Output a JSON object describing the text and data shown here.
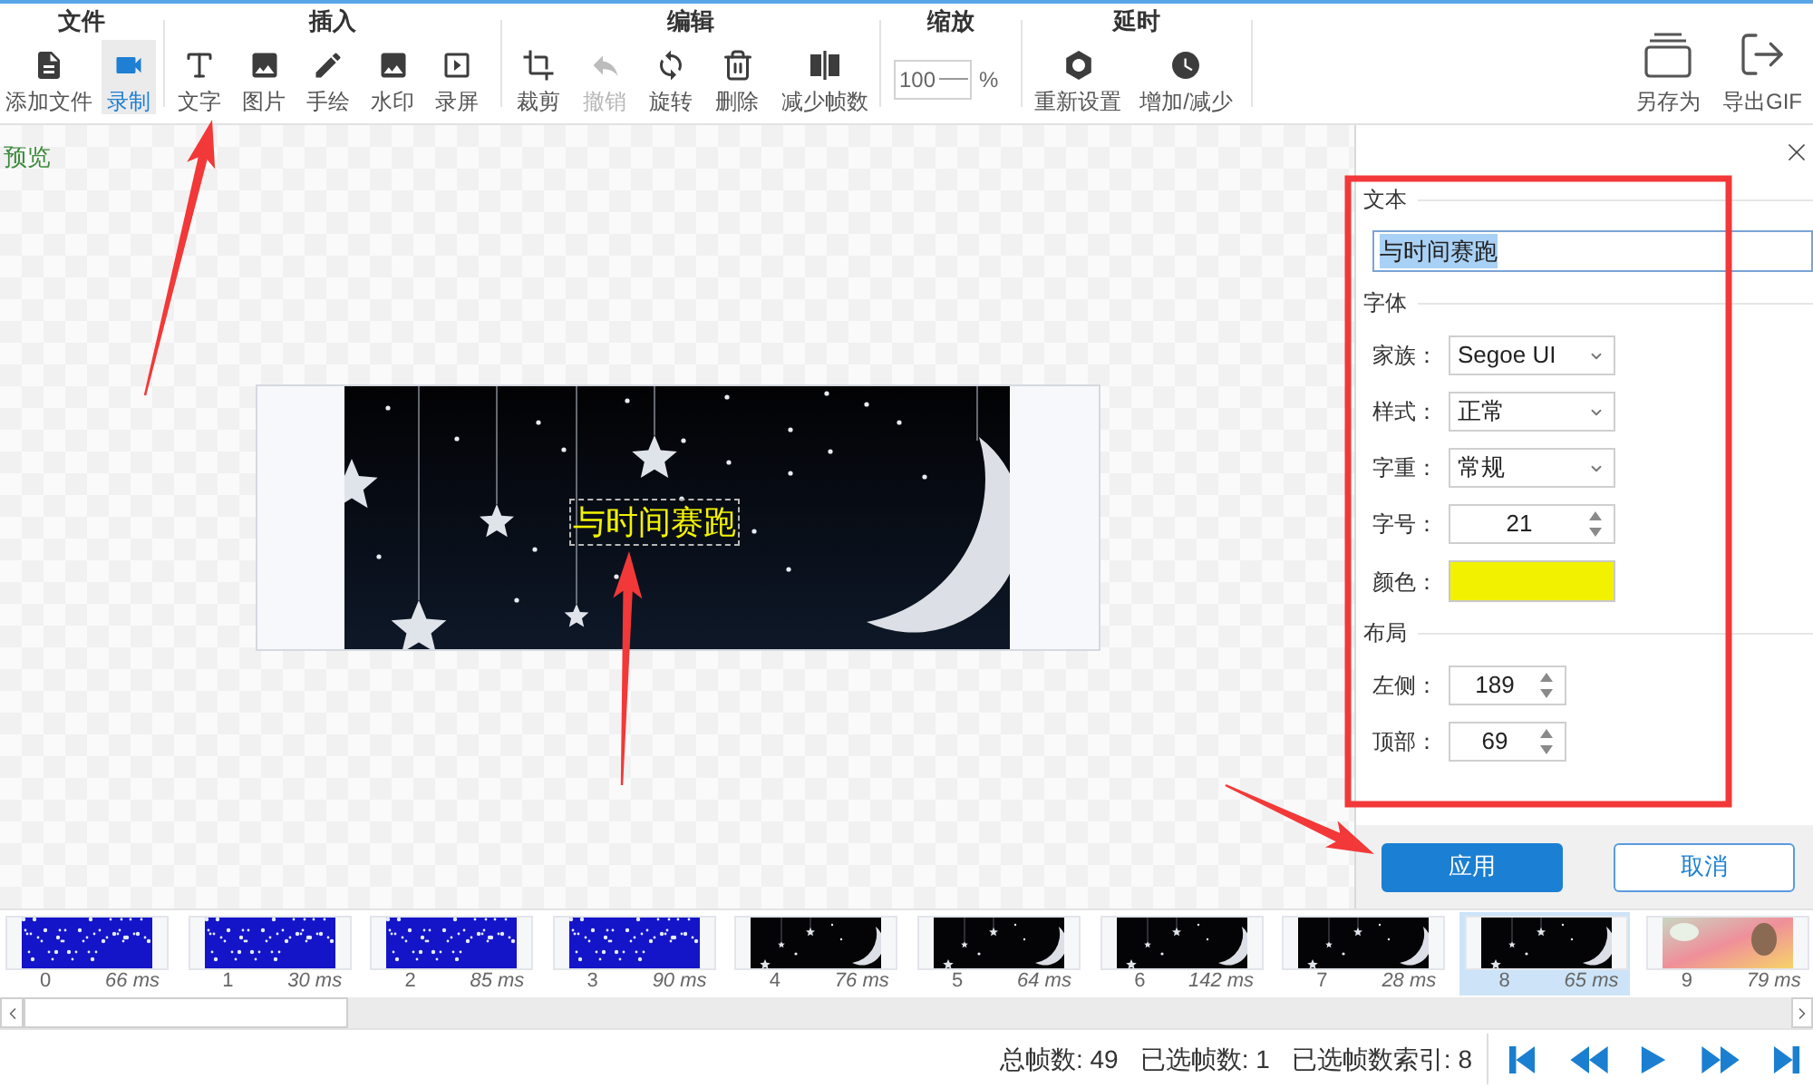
{
  "toolbar": {
    "groups": [
      {
        "title": "文件",
        "kind": "buttons",
        "buttons": [
          {
            "label": "添加文件",
            "selected": false,
            "disabled": false
          },
          {
            "label": "录制",
            "selected": true,
            "disabled": false
          }
        ]
      },
      {
        "title": "插入",
        "kind": "buttons",
        "buttons": [
          {
            "label": "文字",
            "selected": false,
            "disabled": false
          },
          {
            "label": "图片",
            "selected": false,
            "disabled": false
          },
          {
            "label": "手绘",
            "selected": false,
            "disabled": false
          },
          {
            "label": "水印",
            "selected": false,
            "disabled": false
          },
          {
            "label": "录屏",
            "selected": false,
            "disabled": false
          }
        ]
      },
      {
        "title": "编辑",
        "kind": "buttons",
        "buttons": [
          {
            "label": "裁剪",
            "selected": false,
            "disabled": false
          },
          {
            "label": "撤销",
            "selected": false,
            "disabled": true
          },
          {
            "label": "旋转",
            "selected": false,
            "disabled": false
          },
          {
            "label": "删除",
            "selected": false,
            "disabled": false
          },
          {
            "label": "减少帧数",
            "selected": false,
            "disabled": false
          }
        ]
      },
      {
        "title": "缩放",
        "kind": "zoom",
        "value": "100",
        "unit": "%"
      },
      {
        "title": "延时",
        "kind": "buttons",
        "buttons": [
          {
            "label": "重新设置",
            "selected": false,
            "disabled": false
          },
          {
            "label": "增加/减少",
            "selected": false,
            "disabled": false
          }
        ]
      }
    ],
    "actions": [
      {
        "label": "另存为"
      },
      {
        "label": "导出GIF"
      }
    ]
  },
  "preview": {
    "label": "预览",
    "text_layer": {
      "text": "与时间赛跑",
      "selected": true
    }
  },
  "properties": {
    "sections": [
      {
        "title": "文本",
        "fields": [
          {
            "kind": "text",
            "value": "与时间赛跑",
            "selected": true
          }
        ]
      },
      {
        "title": "字体",
        "fields": [
          {
            "kind": "select",
            "label": "家族：",
            "value": "Segoe UI"
          },
          {
            "kind": "select",
            "label": "样式：",
            "value": "正常"
          },
          {
            "kind": "select",
            "label": "字重：",
            "value": "常规"
          },
          {
            "kind": "number",
            "label": "字号：",
            "value": "21"
          },
          {
            "kind": "color",
            "label": "颜色：",
            "color": "#f2f200"
          }
        ]
      },
      {
        "title": "布局",
        "fields": [
          {
            "kind": "number",
            "label": "左侧：",
            "value": "189"
          },
          {
            "kind": "number",
            "label": "顶部：",
            "value": "69"
          }
        ]
      }
    ],
    "buttons": [
      {
        "label": "应用",
        "kind": "primary"
      },
      {
        "label": "取消",
        "kind": "secondary"
      }
    ]
  },
  "filmstrip": {
    "frames": [
      {
        "index": "0",
        "delay": "66 ms",
        "kind": "starfield",
        "selected": false
      },
      {
        "index": "1",
        "delay": "30 ms",
        "kind": "starfield",
        "selected": false
      },
      {
        "index": "2",
        "delay": "85 ms",
        "kind": "starfield",
        "selected": false
      },
      {
        "index": "3",
        "delay": "90 ms",
        "kind": "starfield",
        "selected": false
      },
      {
        "index": "4",
        "delay": "76 ms",
        "kind": "night",
        "selected": false
      },
      {
        "index": "5",
        "delay": "64 ms",
        "kind": "night",
        "selected": false
      },
      {
        "index": "6",
        "delay": "142 ms",
        "kind": "night",
        "selected": false
      },
      {
        "index": "7",
        "delay": "28 ms",
        "kind": "night",
        "selected": false
      },
      {
        "index": "8",
        "delay": "65 ms",
        "kind": "night",
        "selected": true
      },
      {
        "index": "9",
        "delay": "79 ms",
        "kind": "colorful",
        "selected": false
      }
    ]
  },
  "status_bar": {
    "total": "总帧数: 49",
    "selected_count": "已选帧数: 1",
    "selected_index": "已选帧数索引: 8"
  }
}
